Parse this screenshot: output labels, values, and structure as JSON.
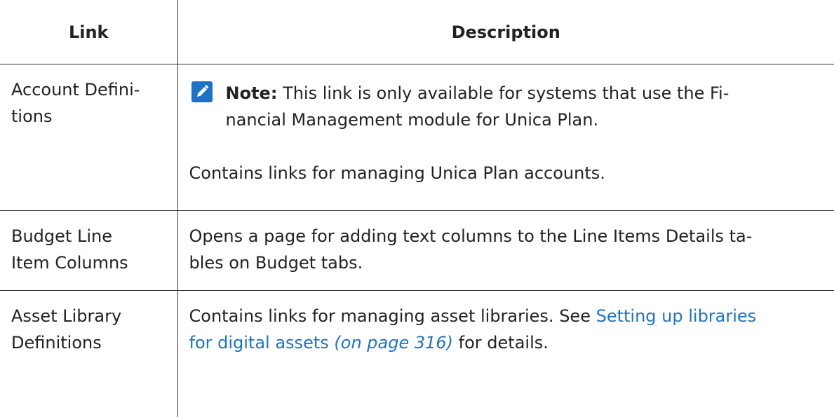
{
  "table": {
    "headers": {
      "link": "Link",
      "description": "Description"
    },
    "rows": [
      {
        "link_lines": [
          "Account Defini-",
          "tions"
        ],
        "note": {
          "icon": "note-pencil-icon",
          "label": "Note:",
          "lines": [
            "This link is only available for systems that use the Fi-",
            "nancial Management module for Unica Plan."
          ]
        },
        "description": "Contains links for managing Unica Plan accounts."
      },
      {
        "link_lines": [
          "Budget Line",
          "Item Columns"
        ],
        "description_lines": [
          "Opens a page for adding text columns to the Line Items Details ta-",
          "bles on Budget tabs."
        ]
      },
      {
        "link_lines": [
          "Asset Library",
          "Definitions"
        ],
        "description_prefix": "Contains links for managing asset libraries. See ",
        "description_link_line1": "Setting up libraries",
        "description_link_line2": "for digital assets",
        "description_page_ref": "(on page 316)",
        "description_suffix": " for details."
      }
    ]
  },
  "colors": {
    "link": "#1a73c9",
    "note_icon_bg": "#1a73c9",
    "border": "#333333",
    "text": "#222222"
  }
}
